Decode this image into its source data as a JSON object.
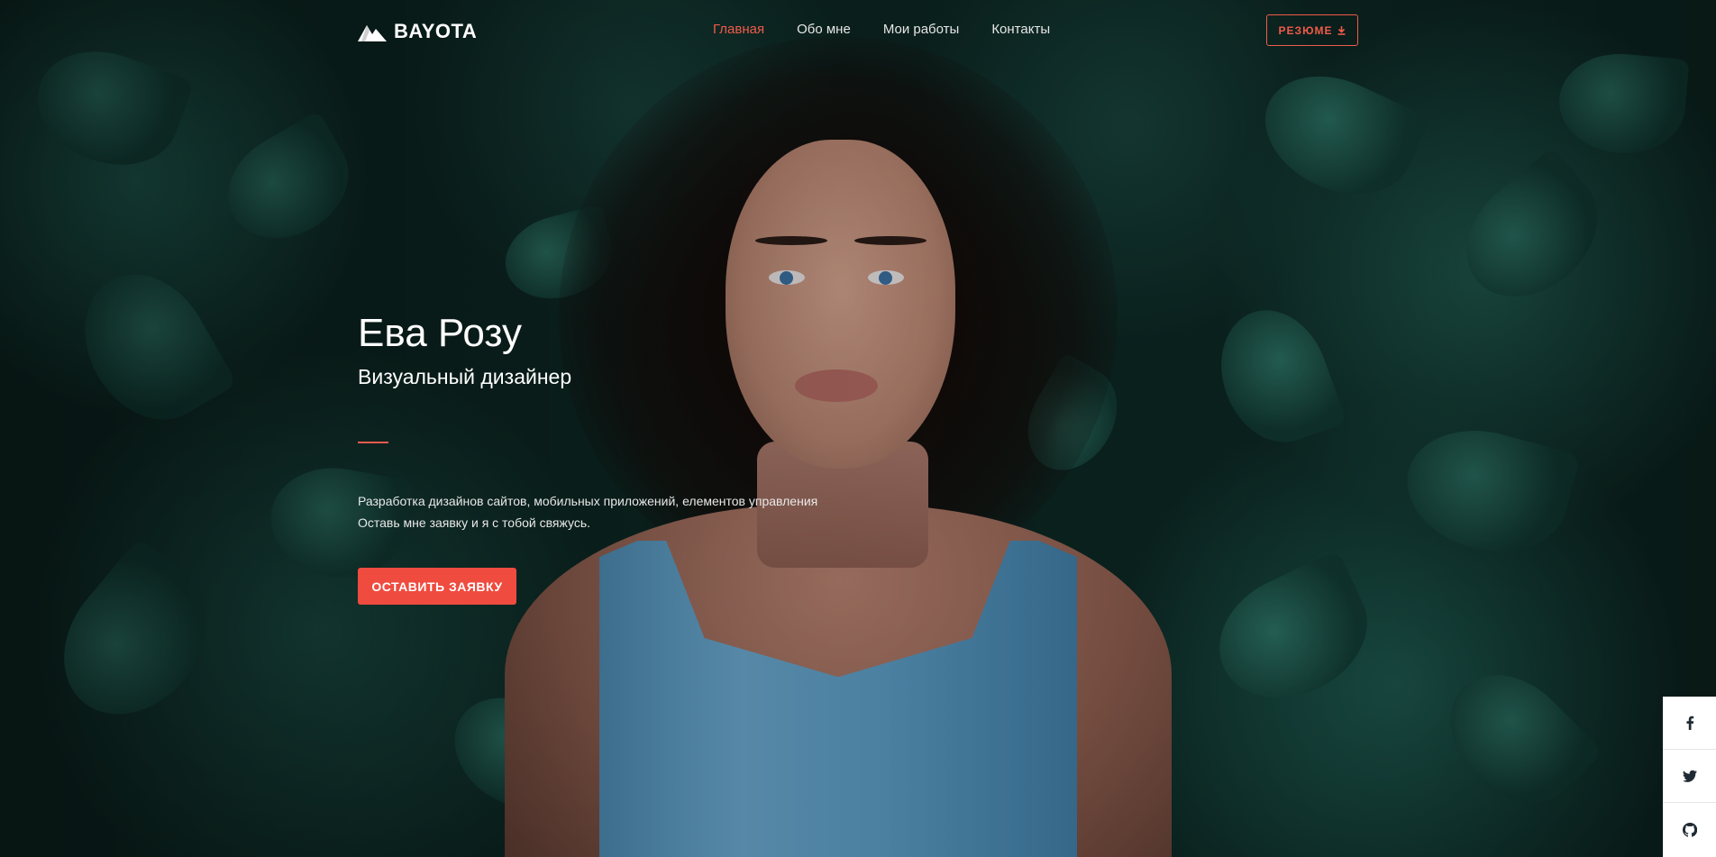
{
  "header": {
    "logo_text": "BAYOTA",
    "nav": [
      {
        "label": "Главная",
        "active": true
      },
      {
        "label": "Обо мне",
        "active": false
      },
      {
        "label": "Мои работы",
        "active": false
      },
      {
        "label": "Контакты",
        "active": false
      }
    ],
    "resume_label": "РЕЗЮМЕ",
    "resume_icon": "download-icon"
  },
  "hero": {
    "name": "Ева Розу",
    "role": "Визуальный дизайнер",
    "desc_line1": "Разработка дизайнов сайтов, мобильных приложений, елементов управления",
    "desc_line2": "Оставь мне заявку и я с тобой свяжусь.",
    "cta_label": "ОСТАВИТЬ ЗАЯВКУ"
  },
  "social": [
    {
      "icon": "facebook-icon"
    },
    {
      "icon": "twitter-icon"
    },
    {
      "icon": "github-icon"
    }
  ],
  "colors": {
    "accent": "#ef5b4a",
    "cta": "#ef4b3f"
  }
}
